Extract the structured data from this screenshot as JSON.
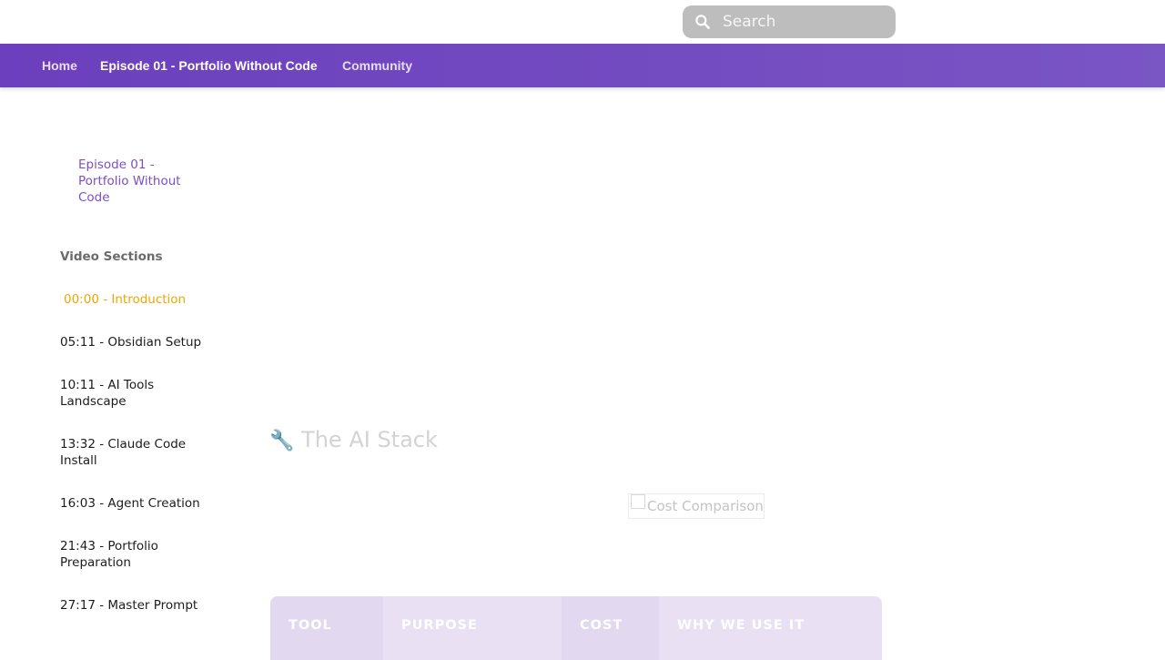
{
  "search": {
    "placeholder": "Search"
  },
  "nav": {
    "home": "Home",
    "episode": "Episode 01 - Portfolio Without Code",
    "community": "Community"
  },
  "sidebar": {
    "episode_link": "Episode 01 - Portfolio Without Code",
    "sections_title": "Video Sections",
    "sections": [
      "00:00 - Introduction",
      "05:11 - Obsidian Setup",
      "10:11 - AI Tools Landscape",
      "13:32 - Claude Code Install",
      "16:03 - Agent Creation",
      "21:43 - Portfolio Preparation",
      "27:17 - Master Prompt"
    ],
    "current_index": 0
  },
  "main": {
    "heading_icon": "🔧",
    "heading": "The AI Stack",
    "image_alt": "Cost Comparison",
    "table_headers": [
      "TOOL",
      "PURPOSE",
      "COST",
      "WHY WE USE IT"
    ]
  },
  "colors": {
    "nav_start": "#6b3fbd",
    "nav_end": "#7a55c4",
    "link_purple": "#7a4fc7",
    "current_section": "#f0a500"
  }
}
